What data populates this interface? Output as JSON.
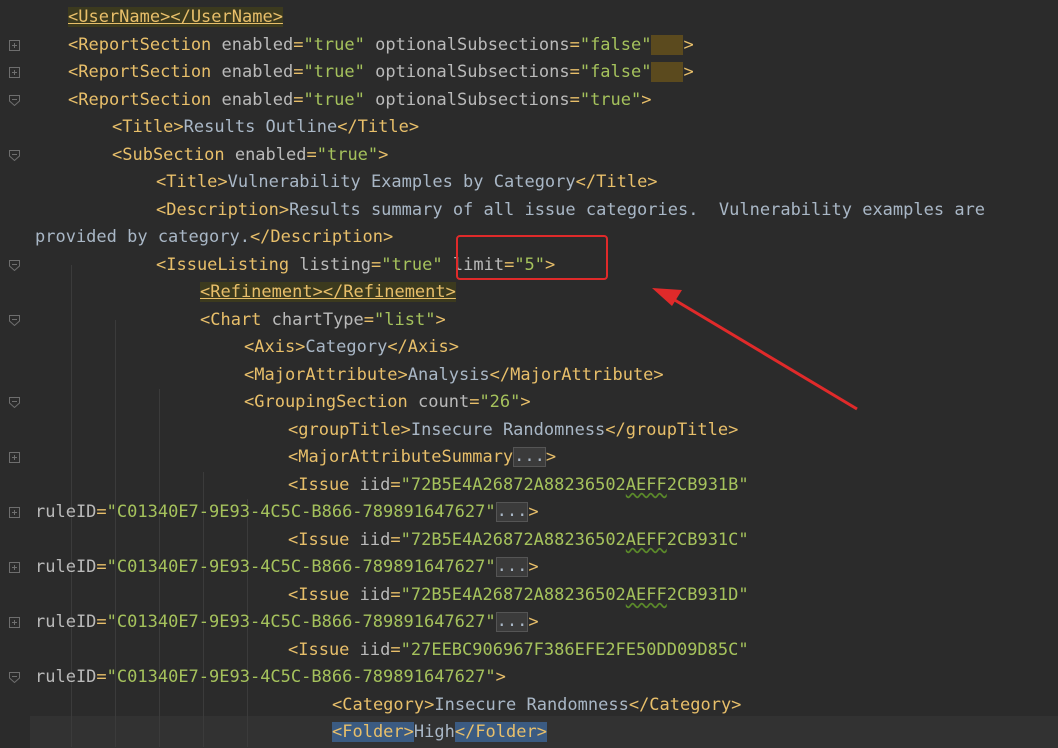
{
  "editor": {
    "lines": [
      {
        "indent": 68,
        "parts": [
          [
            "hl",
            "<UserName></UserName>"
          ]
        ]
      },
      {
        "indent": 68,
        "fold": "plus",
        "parts": [
          [
            "tag",
            "<ReportSection "
          ],
          [
            "aname",
            "enabled"
          ],
          [
            "tag",
            "="
          ],
          [
            "aval",
            "\"true\""
          ],
          [
            "tag",
            " "
          ],
          [
            "aname",
            "optionalSubsections"
          ],
          [
            "tag",
            "="
          ],
          [
            "aval",
            "\"false\""
          ],
          [
            "yph",
            ""
          ],
          [
            "tag",
            ">"
          ]
        ]
      },
      {
        "indent": 68,
        "fold": "plus",
        "parts": [
          [
            "tag",
            "<ReportSection "
          ],
          [
            "aname",
            "enabled"
          ],
          [
            "tag",
            "="
          ],
          [
            "aval",
            "\"true\""
          ],
          [
            "tag",
            " "
          ],
          [
            "aname",
            "optionalSubsections"
          ],
          [
            "tag",
            "="
          ],
          [
            "aval",
            "\"false\""
          ],
          [
            "yph",
            ""
          ],
          [
            "tag",
            ">"
          ]
        ]
      },
      {
        "indent": 68,
        "fold": "minus",
        "parts": [
          [
            "tag",
            "<ReportSection "
          ],
          [
            "aname",
            "enabled"
          ],
          [
            "tag",
            "="
          ],
          [
            "aval",
            "\"true\""
          ],
          [
            "tag",
            " "
          ],
          [
            "aname",
            "optionalSubsections"
          ],
          [
            "tag",
            "="
          ],
          [
            "aval",
            "\"true\""
          ],
          [
            "tag",
            ">"
          ]
        ]
      },
      {
        "indent": 112,
        "parts": [
          [
            "tag",
            "<Title>"
          ],
          [
            "txt",
            "Results Outline"
          ],
          [
            "tag",
            "</Title>"
          ]
        ]
      },
      {
        "indent": 112,
        "fold": "minus",
        "parts": [
          [
            "tag",
            "<SubSection "
          ],
          [
            "aname",
            "enabled"
          ],
          [
            "tag",
            "="
          ],
          [
            "aval",
            "\"true\""
          ],
          [
            "tag",
            ">"
          ]
        ]
      },
      {
        "indent": 156,
        "parts": [
          [
            "tag",
            "<Title>"
          ],
          [
            "txt",
            "Vulnerability Examples by Category"
          ],
          [
            "tag",
            "</Title>"
          ]
        ]
      },
      {
        "indent": 156,
        "parts": [
          [
            "tag",
            "<Description>"
          ],
          [
            "txt",
            "Results summary of all issue categories.  Vulnerability examples are"
          ]
        ]
      },
      {
        "indent": 35,
        "parts": [
          [
            "txt",
            "provided by category."
          ],
          [
            "tag",
            "</Description>"
          ]
        ]
      },
      {
        "indent": 156,
        "fold": "minus",
        "parts": [
          [
            "tag",
            "<IssueListing "
          ],
          [
            "aname",
            "listing"
          ],
          [
            "tag",
            "="
          ],
          [
            "aval",
            "\"true\""
          ],
          [
            "tag",
            " "
          ],
          [
            "aname",
            "limit"
          ],
          [
            "tag",
            "="
          ],
          [
            "aval",
            "\"5\""
          ],
          [
            "tag",
            ">"
          ]
        ]
      },
      {
        "indent": 200,
        "parts": [
          [
            "hl",
            "<Refinement></Refinement>"
          ]
        ]
      },
      {
        "indent": 200,
        "fold": "minus",
        "parts": [
          [
            "tag",
            "<Chart "
          ],
          [
            "aname",
            "chartType"
          ],
          [
            "tag",
            "="
          ],
          [
            "aval",
            "\"list\""
          ],
          [
            "tag",
            ">"
          ]
        ]
      },
      {
        "indent": 244,
        "parts": [
          [
            "tag",
            "<Axis>"
          ],
          [
            "txt",
            "Category"
          ],
          [
            "tag",
            "</Axis>"
          ]
        ]
      },
      {
        "indent": 244,
        "parts": [
          [
            "tag",
            "<MajorAttribute>"
          ],
          [
            "txt",
            "Analysis"
          ],
          [
            "tag",
            "</MajorAttribute>"
          ]
        ]
      },
      {
        "indent": 244,
        "fold": "minus",
        "parts": [
          [
            "tag",
            "<GroupingSection "
          ],
          [
            "aname",
            "count"
          ],
          [
            "tag",
            "="
          ],
          [
            "aval",
            "\"26\""
          ],
          [
            "tag",
            ">"
          ]
        ]
      },
      {
        "indent": 288,
        "parts": [
          [
            "tag",
            "<groupTitle>"
          ],
          [
            "txt",
            "Insecure Randomness"
          ],
          [
            "tag",
            "</groupTitle>"
          ]
        ]
      },
      {
        "indent": 288,
        "fold": "plus",
        "parts": [
          [
            "tag",
            "<MajorAttributeSummary"
          ],
          [
            "ph",
            "..."
          ],
          [
            "tag",
            ">"
          ]
        ]
      },
      {
        "indent": 288,
        "parts": [
          [
            "tag",
            "<Issue "
          ],
          [
            "aname",
            "iid"
          ],
          [
            "tag",
            "="
          ],
          [
            "aval",
            "\"72B5E4A26872A88236502"
          ],
          [
            "squig",
            "AEFF"
          ],
          [
            "aval",
            "2CB931B\""
          ]
        ]
      },
      {
        "indent": 35,
        "fold": "plus",
        "parts": [
          [
            "aname",
            "ruleID"
          ],
          [
            "tag",
            "="
          ],
          [
            "aval",
            "\"C01340E7-9E93-4C5C-B866-789891647627\""
          ],
          [
            "ph",
            "..."
          ],
          [
            "tag",
            ">"
          ]
        ]
      },
      {
        "indent": 288,
        "parts": [
          [
            "tag",
            "<Issue "
          ],
          [
            "aname",
            "iid"
          ],
          [
            "tag",
            "="
          ],
          [
            "aval",
            "\"72B5E4A26872A88236502"
          ],
          [
            "squig",
            "AEFF"
          ],
          [
            "aval",
            "2CB931C\""
          ]
        ]
      },
      {
        "indent": 35,
        "fold": "plus",
        "parts": [
          [
            "aname",
            "ruleID"
          ],
          [
            "tag",
            "="
          ],
          [
            "aval",
            "\"C01340E7-9E93-4C5C-B866-789891647627\""
          ],
          [
            "ph",
            "..."
          ],
          [
            "tag",
            ">"
          ]
        ]
      },
      {
        "indent": 288,
        "parts": [
          [
            "tag",
            "<Issue "
          ],
          [
            "aname",
            "iid"
          ],
          [
            "tag",
            "="
          ],
          [
            "aval",
            "\"72B5E4A26872A88236502"
          ],
          [
            "squig",
            "AEFF"
          ],
          [
            "aval",
            "2CB931D\""
          ]
        ]
      },
      {
        "indent": 35,
        "fold": "plus",
        "parts": [
          [
            "aname",
            "ruleID"
          ],
          [
            "tag",
            "="
          ],
          [
            "aval",
            "\"C01340E7-9E93-4C5C-B866-789891647627\""
          ],
          [
            "ph",
            "..."
          ],
          [
            "tag",
            ">"
          ]
        ]
      },
      {
        "indent": 288,
        "parts": [
          [
            "tag",
            "<Issue "
          ],
          [
            "aname",
            "iid"
          ],
          [
            "tag",
            "="
          ],
          [
            "aval",
            "\"27EEBC906967F386EFE2FE50DD09D85C\""
          ]
        ]
      },
      {
        "indent": 35,
        "fold": "minus",
        "parts": [
          [
            "aname",
            "ruleID"
          ],
          [
            "tag",
            "="
          ],
          [
            "aval",
            "\"C01340E7-9E93-4C5C-B866-789891647627\""
          ],
          [
            "tag",
            ">"
          ]
        ]
      },
      {
        "indent": 332,
        "parts": [
          [
            "tag",
            "<Category>"
          ],
          [
            "txt",
            "Insecure Randomness"
          ],
          [
            "tag",
            "</Category>"
          ]
        ]
      },
      {
        "indent": 332,
        "parts": [
          [
            "match",
            "<Folder>"
          ],
          [
            "txt",
            "High"
          ],
          [
            "match",
            "</Folder>"
          ]
        ]
      }
    ]
  }
}
